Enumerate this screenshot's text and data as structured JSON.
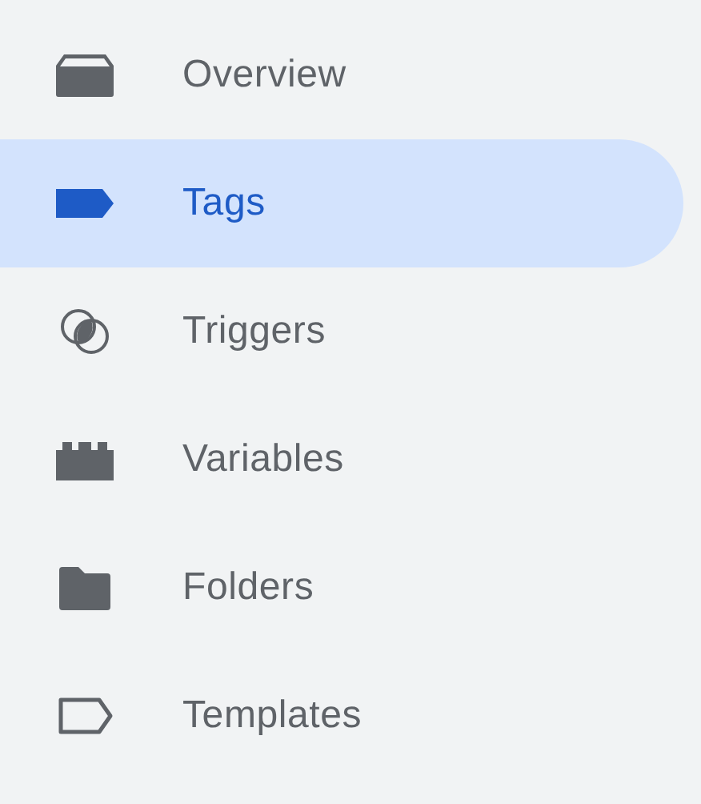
{
  "nav_items": [
    {
      "label": "Overview",
      "selected": false
    },
    {
      "label": "Tags",
      "selected": true
    },
    {
      "label": "Triggers",
      "selected": false
    },
    {
      "label": "Variables",
      "selected": false
    },
    {
      "label": "Folders",
      "selected": false
    },
    {
      "label": "Templates",
      "selected": false
    }
  ]
}
